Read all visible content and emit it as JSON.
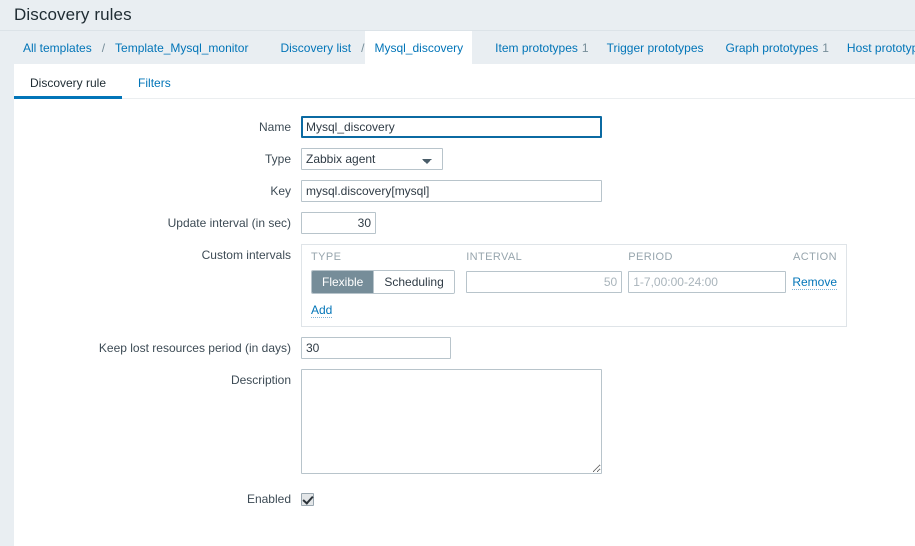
{
  "header": {
    "title": "Discovery rules"
  },
  "nav": {
    "breadcrumbs": [
      {
        "label": "All templates",
        "current": false
      },
      {
        "label": "Template_Mysql_monitor",
        "current": false
      },
      {
        "label": "Discovery list",
        "current": false
      },
      {
        "label": "Mysql_discovery",
        "current": true
      }
    ],
    "separator": "/",
    "links": [
      {
        "label": "Item prototypes",
        "count": "1"
      },
      {
        "label": "Trigger prototypes",
        "count": ""
      },
      {
        "label": "Graph prototypes",
        "count": "1"
      },
      {
        "label": "Host prototypes",
        "count": ""
      }
    ]
  },
  "tabs": [
    {
      "label": "Discovery rule",
      "active": true
    },
    {
      "label": "Filters",
      "active": false
    }
  ],
  "form": {
    "name": {
      "label": "Name",
      "value": "Mysql_discovery"
    },
    "type": {
      "label": "Type",
      "value": "Zabbix agent",
      "options": [
        "Zabbix agent"
      ]
    },
    "key": {
      "label": "Key",
      "value": "mysql.discovery[mysql]"
    },
    "update_interval": {
      "label": "Update interval (in sec)",
      "value": "30"
    },
    "custom_intervals": {
      "label": "Custom intervals",
      "columns": [
        "TYPE",
        "INTERVAL",
        "PERIOD",
        "ACTION"
      ],
      "rows": [
        {
          "type_options": [
            "Flexible",
            "Scheduling"
          ],
          "type_selected": "Flexible",
          "interval_value": "",
          "interval_placeholder": "50",
          "period_value": "",
          "period_placeholder": "1-7,00:00-24:00",
          "action_label": "Remove"
        }
      ],
      "add_label": "Add"
    },
    "keep_lost": {
      "label": "Keep lost resources period (in days)",
      "value": "30"
    },
    "description": {
      "label": "Description",
      "value": ""
    },
    "enabled": {
      "label": "Enabled",
      "checked": true
    }
  },
  "colors": {
    "accent": "#0275b8",
    "header_bg": "#e9eef2",
    "toggle_selected_bg": "#768d99",
    "focus_border": "#0b6aa2"
  }
}
